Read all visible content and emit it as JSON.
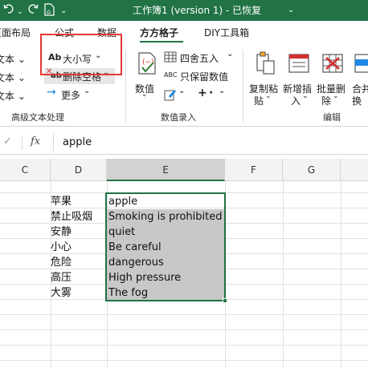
{
  "titlebar": {
    "title": "工作簿1 (version 1)  -  已恢复",
    "dropdown": "⌄",
    "undo_icon": "undo-icon",
    "redo_icon": "redo-icon",
    "file_icon": "file-icon",
    "more_icon": "quick-access-more-icon"
  },
  "tabs": [
    {
      "label": "页面布局",
      "active": false
    },
    {
      "label": "公式",
      "active": false
    },
    {
      "label": "数据",
      "active": false
    },
    {
      "label": "方方格子",
      "active": true
    },
    {
      "label": "DIY工具箱",
      "active": false
    }
  ],
  "ribbon": {
    "left_items": [
      "文本 ⌄",
      "文本 ⌄",
      "文本 ⌄"
    ],
    "case_button": {
      "icon_text": "Ab",
      "label": "大小写"
    },
    "trim_button": {
      "icon_text": "ab",
      "label": "删除空格"
    },
    "more_button": {
      "label": "更多"
    },
    "group1_label": "高级文本处理",
    "numeric_button": {
      "label": "数值"
    },
    "round_button": {
      "label": "四舍五入"
    },
    "keep_numeric_button": {
      "icon_text": "ABC",
      "label": "只保留数值"
    },
    "group2_label": "数值录入",
    "copy_paste": {
      "line1": "复制粘",
      "line2": "贴"
    },
    "add_insert": {
      "line1": "新增插",
      "line2": "入"
    },
    "batch_delete": {
      "line1": "批量删",
      "line2": "除"
    },
    "merge_convert": {
      "line1": "合并",
      "line2": "换"
    },
    "group3_label": "编辑",
    "accent_color": "#217346",
    "highlight_color": "#e53935"
  },
  "formula_bar": {
    "check_icon": "✓",
    "fx": "fx",
    "value": "apple"
  },
  "sheet": {
    "columns": [
      "C",
      "D",
      "E",
      "F",
      "G"
    ],
    "column_d": [
      "苹果",
      "禁止吸烟",
      "安静",
      "小心",
      "危险",
      "高压",
      "大雾"
    ],
    "column_e": [
      "apple",
      "Smoking is prohibited",
      "quiet",
      "Be careful",
      "dangerous",
      "High pressure",
      "The fog"
    ],
    "selected_column": "E"
  }
}
